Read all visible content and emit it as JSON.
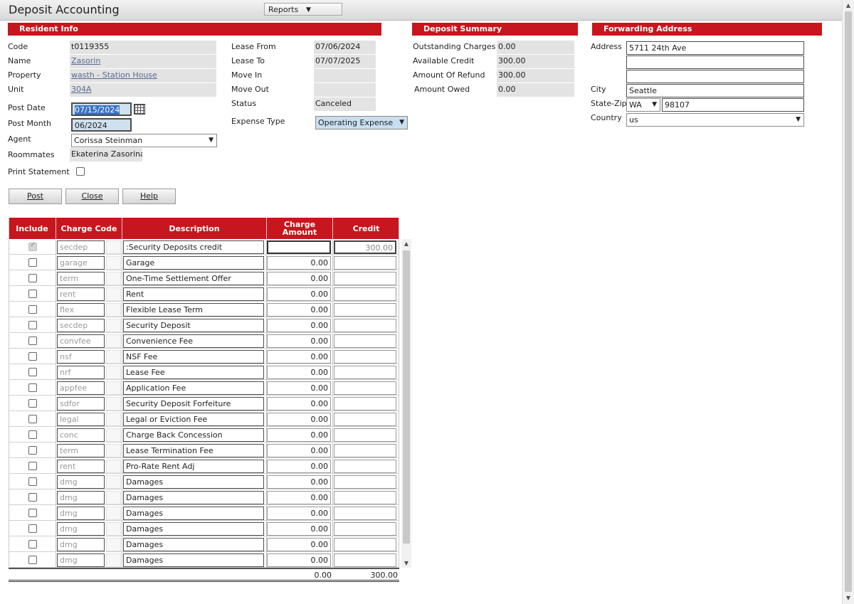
{
  "app": {
    "title": "Deposit Accounting",
    "reports_label": "Reports"
  },
  "resident": {
    "header": "Resident Info",
    "code_label": "Code",
    "code": "t0119355",
    "name_label": "Name",
    "name": "Zasorin",
    "property_label": "Property",
    "property": "wasth - Station House",
    "unit_label": "Unit",
    "unit": "304A",
    "post_date_label": "Post Date",
    "post_date": "07/15/2024",
    "post_month_label": "Post Month",
    "post_month": "06/2024",
    "agent_label": "Agent",
    "agent": "Corissa Steinman",
    "roommates_label": "Roommates",
    "roommates": "Ekaterina Zasorina",
    "print_label": "Print Statement",
    "lease_from_label": "Lease From",
    "lease_from": "07/06/2024",
    "lease_to_label": "Lease To",
    "lease_to": "07/07/2025",
    "move_in_label": "Move In",
    "move_in": "",
    "move_out_label": "Move Out",
    "move_out": "",
    "status_label": "Status",
    "status": "Canceled",
    "expense_type_label": "Expense Type",
    "expense_type": "Operating Expense"
  },
  "deposit_summary": {
    "header": "Deposit Summary",
    "outstanding_label": "Outstanding Charges",
    "outstanding": "0.00",
    "available_label": "Available Credit",
    "available": "300.00",
    "refund_label": "Amount Of Refund",
    "refund": "300.00",
    "owed_label": "Amount Owed",
    "owed": "0.00"
  },
  "forwarding": {
    "header": "Forwarding Address",
    "address_label": "Address",
    "address1": "5711 24th Ave",
    "address2": "",
    "address3": "",
    "city_label": "City",
    "city": "Seattle",
    "state_zip_label": "State-Zip",
    "state": "WA",
    "zip": "98107",
    "country_label": "Country",
    "country": "us"
  },
  "buttons": {
    "post": "Post",
    "close": "Close",
    "help": "Help"
  },
  "grid": {
    "headers": {
      "include": "Include",
      "charge_code": "Charge Code",
      "description": "Description",
      "charge_amount": "Charge Amount",
      "credit": "Credit"
    },
    "rows": [
      {
        "code": "secdep",
        "desc": ":Security Deposits credit",
        "amount": "",
        "credit": "300.00",
        "locked": true
      },
      {
        "code": "garage",
        "desc": "Garage",
        "amount": "0.00",
        "credit": ""
      },
      {
        "code": "term",
        "desc": "One-Time Settlement Offer",
        "amount": "0.00",
        "credit": ""
      },
      {
        "code": "rent",
        "desc": "Rent",
        "amount": "0.00",
        "credit": ""
      },
      {
        "code": "flex",
        "desc": "Flexible Lease Term",
        "amount": "0.00",
        "credit": ""
      },
      {
        "code": "secdep",
        "desc": "Security Deposit",
        "amount": "0.00",
        "credit": ""
      },
      {
        "code": "convfee",
        "desc": "Convenience Fee",
        "amount": "0.00",
        "credit": ""
      },
      {
        "code": "nsf",
        "desc": "NSF Fee",
        "amount": "0.00",
        "credit": ""
      },
      {
        "code": "nrf",
        "desc": "Lease Fee",
        "amount": "0.00",
        "credit": ""
      },
      {
        "code": "appfee",
        "desc": "Application Fee",
        "amount": "0.00",
        "credit": ""
      },
      {
        "code": "sdfor",
        "desc": "Security Deposit Forfeiture",
        "amount": "0.00",
        "credit": ""
      },
      {
        "code": "legal",
        "desc": "Legal or Eviction Fee",
        "amount": "0.00",
        "credit": ""
      },
      {
        "code": "conc",
        "desc": "Charge Back Concession",
        "amount": "0.00",
        "credit": ""
      },
      {
        "code": "term",
        "desc": "Lease Termination Fee",
        "amount": "0.00",
        "credit": ""
      },
      {
        "code": "rent",
        "desc": "Pro-Rate Rent Adj",
        "amount": "0.00",
        "credit": ""
      },
      {
        "code": "dmg",
        "desc": "Damages",
        "amount": "0.00",
        "credit": ""
      },
      {
        "code": "dmg",
        "desc": "Damages",
        "amount": "0.00",
        "credit": ""
      },
      {
        "code": "dmg",
        "desc": "Damages",
        "amount": "0.00",
        "credit": ""
      },
      {
        "code": "dmg",
        "desc": "Damages",
        "amount": "0.00",
        "credit": ""
      },
      {
        "code": "dmg",
        "desc": "Damages",
        "amount": "0.00",
        "credit": ""
      },
      {
        "code": "dmg",
        "desc": "Damages",
        "amount": "0.00",
        "credit": ""
      }
    ],
    "total_amount": "0.00",
    "total_credit": "300.00"
  },
  "colors": {
    "section_header": "#c8161e"
  }
}
